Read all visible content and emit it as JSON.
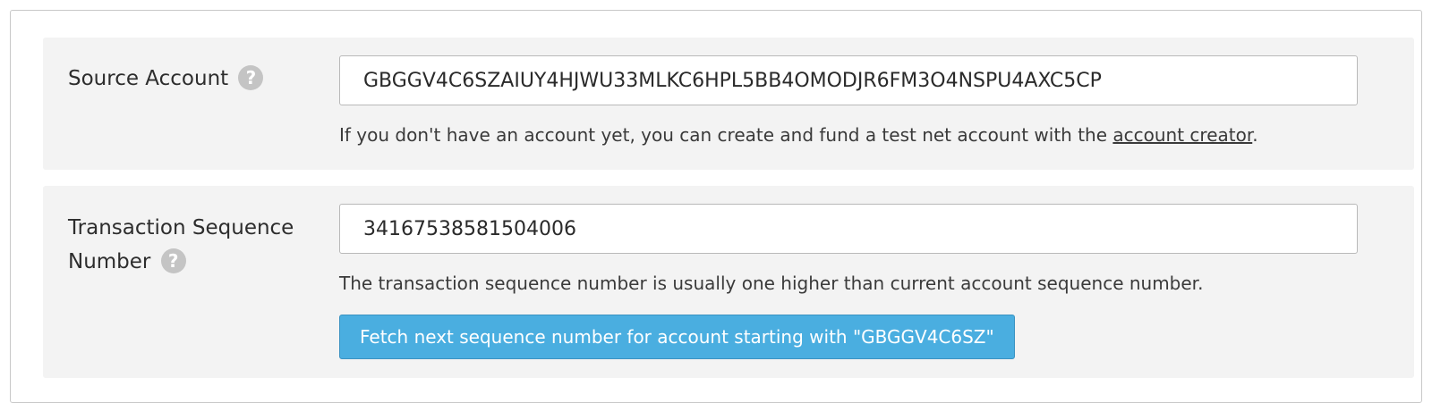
{
  "source_account": {
    "label": "Source Account",
    "help_symbol": "?",
    "value": "GBGGV4C6SZAIUY4HJWU33MLKC6HPL5BB4OMODJR6FM3O4NSPU4AXC5CP",
    "note_prefix": "If you don't have an account yet, you can create and fund a test net account with the ",
    "note_link": "account creator",
    "note_suffix": "."
  },
  "sequence_number": {
    "label_line1": "Transaction Sequence",
    "label_line2": "Number",
    "help_symbol": "?",
    "value": "34167538581504006",
    "note": "The transaction sequence number is usually one higher than current account sequence number.",
    "fetch_button_label": "Fetch next sequence number for account starting with \"GBGGV4C6SZ\""
  },
  "colors": {
    "row_background": "#f3f3f3",
    "button_background": "#4aaee0",
    "help_icon": "#c4c4c4"
  }
}
